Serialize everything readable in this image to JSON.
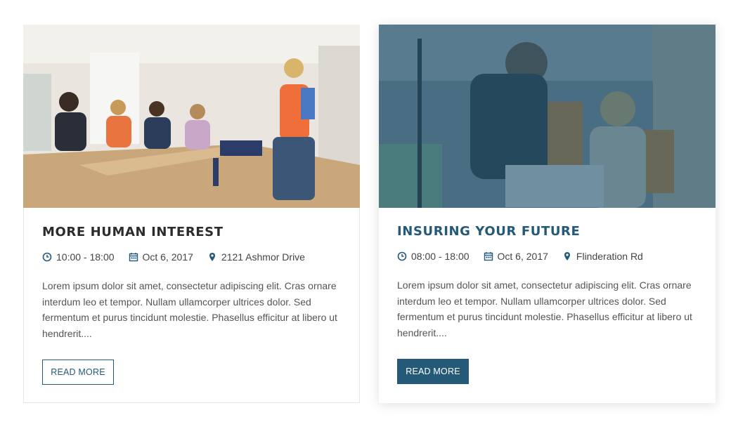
{
  "cards": [
    {
      "title": "MORE HUMAN INTEREST",
      "time": "10:00 - 18:00",
      "date": "Oct 6, 2017",
      "location": "2121 Ashmor Drive",
      "excerpt": "Lorem ipsum dolor sit amet, consectetur adipiscing elit. Cras ornare interdum leo et tempor. Nullam ullamcorper ultrices dolor. Sed fermentum et purus tincidunt molestie. Phasellus efficitur at libero ut hendrerit....",
      "button": "READ MORE",
      "image": "classroom-meeting-photo"
    },
    {
      "title": "INSURING YOUR FUTURE",
      "time": "08:00 - 18:00",
      "date": "Oct 6, 2017",
      "location": "Flinderation Rd",
      "excerpt": "Lorem ipsum dolor sit amet, consectetur adipiscing elit. Cras ornare interdum leo et tempor. Nullam ullamcorper ultrices dolor. Sed fermentum et purus tincidunt molestie. Phasellus efficitur at libero ut hendrerit....",
      "button": "READ MORE",
      "image": "office-laptop-photo"
    }
  ],
  "icons": {
    "time": "clock-icon",
    "date": "calendar-icon",
    "location": "map-marker-icon"
  },
  "colors": {
    "accent": "#245a78",
    "title_dark": "#2c2c2c",
    "text": "#555555"
  }
}
